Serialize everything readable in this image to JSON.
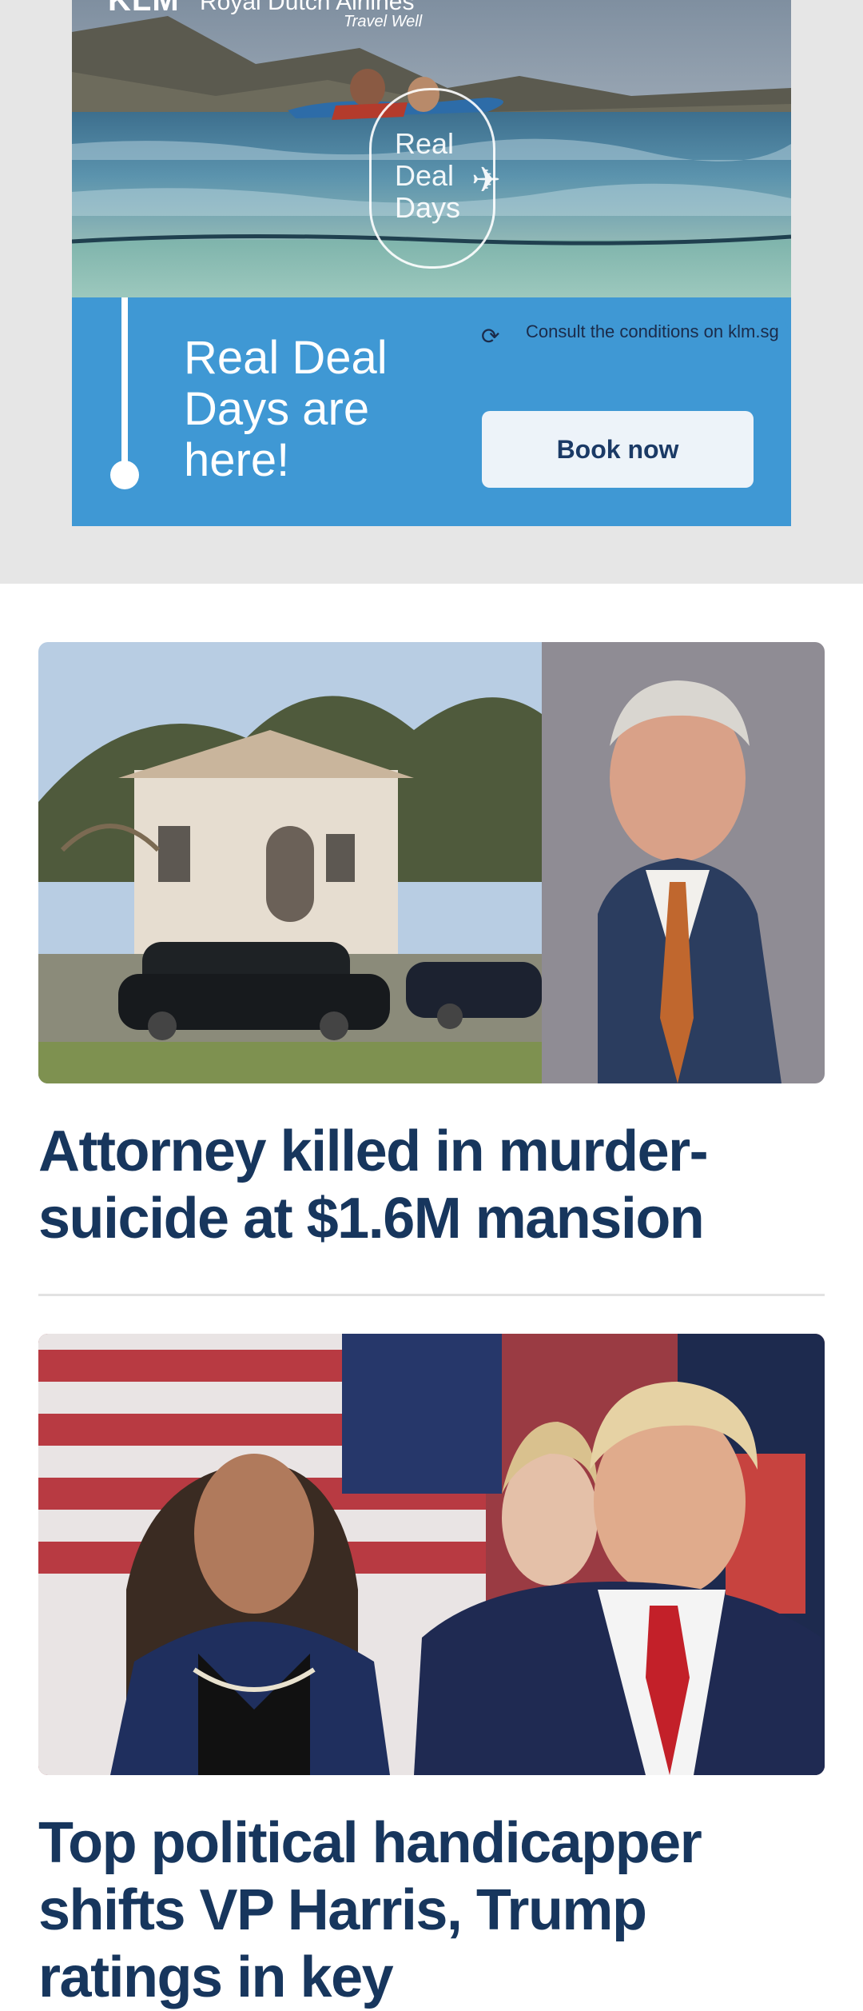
{
  "ad": {
    "brand_logo": "KLM",
    "brand_name": "Royal Dutch Airlines",
    "brand_tagline": "Travel Well",
    "badge_text": [
      "Real",
      "Deal",
      "Days"
    ],
    "headline": "Real Deal Days are here!",
    "conditions": "Consult the conditions on klm.sg",
    "button_label": "Book now",
    "refresh_icon": "refresh-icon",
    "colors": {
      "panel": "#3f98d4",
      "button_bg": "#edf3f9",
      "button_text": "#1b3a66"
    }
  },
  "articles": [
    {
      "headline": "Attorney killed in murder-suicide at $1.6M mansion",
      "image": "mansion-and-attorney-photo"
    },
    {
      "headline": "Top political handicapper shifts VP Harris, Trump ratings in key",
      "image": "harris-trump-photo"
    }
  ],
  "colors": {
    "headline": "#17365d",
    "divider": "#e2e2e2",
    "ad_background": "#e6e6e6"
  }
}
